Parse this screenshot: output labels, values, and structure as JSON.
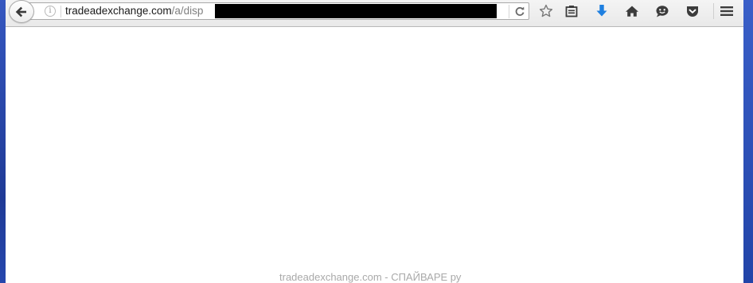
{
  "browser": {
    "url": {
      "domain": "tradeadexchange.com",
      "path": "/a/disp"
    },
    "info_glyph": "i",
    "icons": {
      "back": "back-arrow-icon",
      "reload": "reload-icon",
      "bookmark_star": "bookmark-star-icon",
      "reading_list": "bookmarks-list-icon",
      "download": "download-arrow-icon",
      "home": "home-icon",
      "chat": "hello-chat-icon",
      "pocket": "pocket-icon",
      "menu": "hamburger-menu-icon"
    }
  },
  "colors": {
    "download_accent": "#1e7fe0",
    "desktop_blue": "#2b4aa8",
    "toolbar_bg": "#ececec"
  },
  "watermark": "tradeadexchange.com - СПАЙВАРЕ ру"
}
